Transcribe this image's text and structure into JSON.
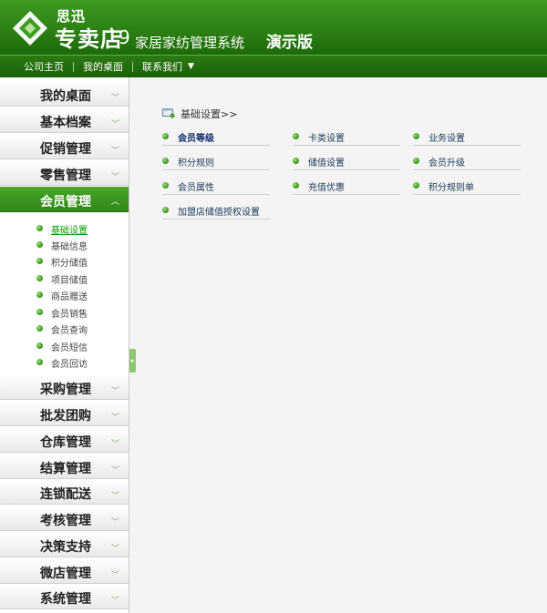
{
  "header": {
    "brand_small": "思迅",
    "brand_big": "专卖店",
    "version": "9",
    "system_name": "家居家纺管理系统",
    "demo_label": "演示版"
  },
  "topnav": {
    "links": [
      "公司主页",
      "我的桌面",
      "联系我们"
    ],
    "dropdown_icon": "triangle-down-icon"
  },
  "sidebar": {
    "menus": [
      {
        "label": "我的桌面"
      },
      {
        "label": "基本档案"
      },
      {
        "label": "促销管理"
      },
      {
        "label": "零售管理"
      },
      {
        "label": "会员管理",
        "active": true
      },
      {
        "label": "采购管理"
      },
      {
        "label": "批发团购"
      },
      {
        "label": "仓库管理"
      },
      {
        "label": "结算管理"
      },
      {
        "label": "连锁配送"
      },
      {
        "label": "考核管理"
      },
      {
        "label": "决策支持"
      },
      {
        "label": "微店管理"
      },
      {
        "label": "系统管理"
      }
    ],
    "submenu": [
      "基础设置",
      "基础信息",
      "积分储值",
      "项目储值",
      "商品赠送",
      "会员销售",
      "会员查询",
      "会员短信",
      "会员回访"
    ],
    "current_submenu": "基础设置"
  },
  "content": {
    "section_title": "基础设置>>",
    "links": [
      "会员等级",
      "卡类设置",
      "业务设置",
      "积分规则",
      "储值设置",
      "会员升级",
      "会员属性",
      "充值优惠",
      "积分规则单",
      "加盟店储值授权设置"
    ]
  }
}
